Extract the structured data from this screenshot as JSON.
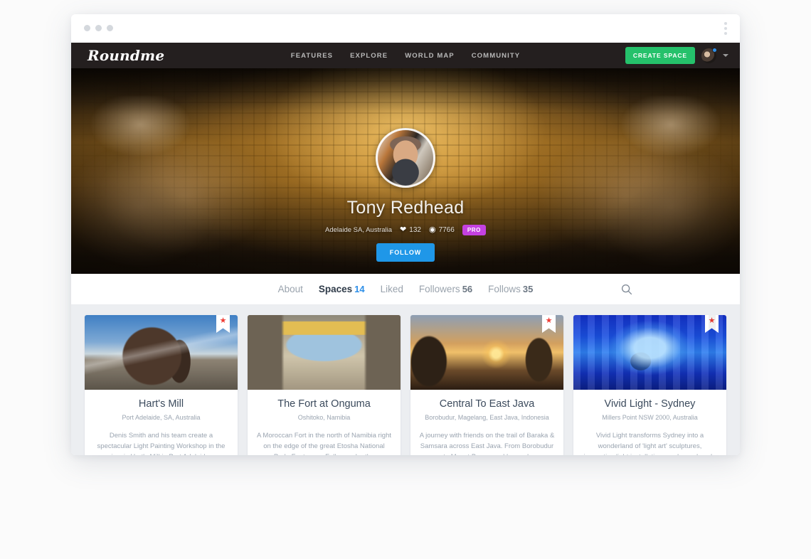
{
  "browser": {
    "dots_count": 3,
    "menu_icon": "kebab-menu-icon"
  },
  "nav": {
    "logo": "Roundme",
    "links": [
      {
        "label": "FEATURES"
      },
      {
        "label": "EXPLORE"
      },
      {
        "label": "WORLD MAP"
      },
      {
        "label": "COMMUNITY"
      }
    ],
    "create_space_label": "CREATE SPACE",
    "create_space_color": "#25c16b",
    "avatar_icon": "user-avatar-icon",
    "caret_icon": "chevron-down-icon",
    "bg_color": "#241f1f"
  },
  "profile": {
    "avatar_icon": "profile-avatar",
    "name": "Tony Redhead",
    "location": "Adelaide SA, Australia",
    "likes_icon": "heart-icon",
    "likes": "132",
    "views_icon": "eye-icon",
    "views": "7766",
    "pro_badge": "PRO",
    "pro_color": "#c441e0",
    "follow_label": "FOLLOW",
    "follow_color": "#1f97e8"
  },
  "tabs": {
    "items": [
      {
        "label": "About",
        "count": "",
        "active": false
      },
      {
        "label": "Spaces",
        "count": "14",
        "active": true
      },
      {
        "label": "Liked",
        "count": "",
        "active": false
      },
      {
        "label": "Followers",
        "count": "56",
        "active": false
      },
      {
        "label": "Follows",
        "count": "35",
        "active": false
      }
    ],
    "search_icon": "search-icon"
  },
  "cards": [
    {
      "badge_icon": "star-ribbon-icon",
      "title": "Hart's Mill",
      "location": "Port Adelaide, SA, Australia",
      "description": "Denis Smith and his team create a spectacular Light Painting Workshop in the iconic Hart's Mill in Port Adelaide."
    },
    {
      "badge_icon": "star-ribbon-icon",
      "title": "The Fort at Onguma",
      "location": "Oshitoko, Namibia",
      "description": "A Moroccan Fort in the north of Namibia right on the edge of the great Etosha National Park. Fantasy or Folly, you be the"
    },
    {
      "badge_icon": "star-ribbon-icon",
      "title": "Central To East Java",
      "location": "Borobudur, Magelang, East Java, Indonesia",
      "description": "A journey with friends on the trail of Baraka & Samsara across East Java. From Borobudur to Mount Bromo and beyond."
    },
    {
      "badge_icon": "star-ribbon-icon",
      "title": "Vivid Light - Sydney",
      "location": "Millers Point NSW 2000, Australia",
      "description": "Vivid Light transforms Sydney into a wonderland of 'light art' sculptures, innovative light installations and grand-scale"
    }
  ]
}
